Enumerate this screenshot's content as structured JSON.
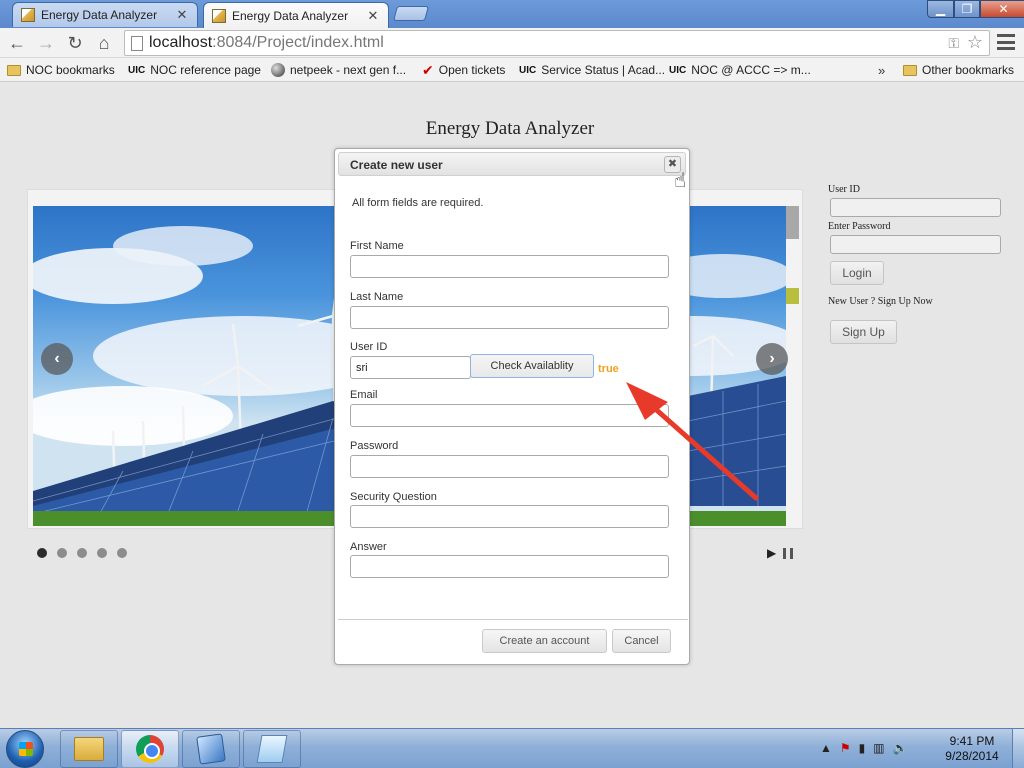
{
  "tabs": [
    {
      "title": "Energy Data Analyzer",
      "active": false
    },
    {
      "title": "Energy Data Analyzer",
      "active": true
    }
  ],
  "toolbar": {
    "url_host": "localhost",
    "url_rest": ":8084/Project/index.html"
  },
  "bookmarks": {
    "items": [
      {
        "label": "NOC bookmarks",
        "icon": "folder-icon"
      },
      {
        "label": "NOC reference page",
        "icon": "uic-icon",
        "prefix": "UIC"
      },
      {
        "label": "netpeek - next gen f...",
        "icon": "globe-icon"
      },
      {
        "label": "Open tickets",
        "icon": "check-icon"
      },
      {
        "label": "Service Status | Acad...",
        "icon": "uic-icon",
        "prefix": "UIC"
      },
      {
        "label": "NOC @ ACCC => m...",
        "icon": "uic-icon",
        "prefix": "UIC"
      }
    ],
    "overflow": "»",
    "other": "Other bookmarks"
  },
  "page": {
    "title": "Energy Data Analyzer",
    "slider": {
      "prev": "‹",
      "next": "›",
      "dot_count": 5,
      "active_dot": 0
    },
    "login": {
      "userid_label": "User ID",
      "password_label": "Enter Password",
      "login_button": "Login",
      "new_user_text": "New User ? Sign Up Now",
      "signup_button": "Sign Up"
    }
  },
  "dialog": {
    "title": "Create new user",
    "close": "✖",
    "note": "All form fields are required.",
    "fields": {
      "first_name": {
        "label": "First Name",
        "value": ""
      },
      "last_name": {
        "label": "Last Name",
        "value": ""
      },
      "user_id": {
        "label": "User ID",
        "value": "sri"
      },
      "email": {
        "label": "Email",
        "value": ""
      },
      "password": {
        "label": "Password",
        "value": ""
      },
      "security_question": {
        "label": "Security Question",
        "value": ""
      },
      "answer": {
        "label": "Answer",
        "value": ""
      }
    },
    "check_button": "Check Availablity",
    "availability_result": "true",
    "create_button": "Create an account",
    "cancel_button": "Cancel"
  },
  "taskbar": {
    "time": "9:41 PM",
    "date": "9/28/2014",
    "pinned": [
      "explorer-icon",
      "chrome-icon",
      "virtualbox-icon",
      "notepad-icon"
    ]
  },
  "colors": {
    "availability_text": "#f0a020",
    "annotation_arrow": "#e83a2a",
    "page_background": "#e6e6e6"
  }
}
